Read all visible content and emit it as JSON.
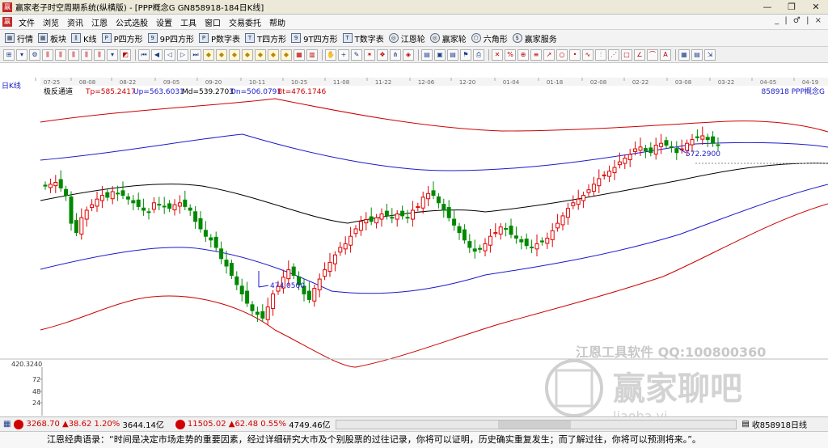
{
  "window": {
    "title": "赢家老子时空周期系统(纵横版) - [PPP概念G  GN858918-184日K线]",
    "min_label": "—",
    "max_label": "❐",
    "close_label": "✕"
  },
  "menu": {
    "items": [
      "文件",
      "浏览",
      "资讯",
      "江恩",
      "公式选股",
      "设置",
      "工具",
      "窗口",
      "交易委托",
      "帮助"
    ],
    "mdi_controls": "_ | ♂ | ×"
  },
  "toolbar1": {
    "items": [
      {
        "label": "行情",
        "icon": "grid-icon",
        "glyph": "▦"
      },
      {
        "label": "板块",
        "icon": "block-icon",
        "glyph": "▦"
      },
      {
        "label": "K线",
        "icon": "kline-icon",
        "glyph": "⫼"
      },
      {
        "label": "P四方形",
        "icon": "p-square-icon",
        "glyph": "P"
      },
      {
        "label": "9P四方形",
        "icon": "9p-square-icon",
        "glyph": "9P"
      },
      {
        "label": "P数字表",
        "icon": "p-table-icon",
        "glyph": "PN"
      },
      {
        "label": "T四方形",
        "icon": "t-square-icon",
        "glyph": "T"
      },
      {
        "label": "9T四方形",
        "icon": "9t-square-icon",
        "glyph": "9T"
      },
      {
        "label": "T数字表",
        "icon": "t-table-icon",
        "glyph": "TN"
      },
      {
        "label": "江恩轮",
        "icon": "gann-wheel-icon",
        "glyph": "◎"
      },
      {
        "label": "赢家轮",
        "icon": "winner-wheel-icon",
        "glyph": "◎"
      },
      {
        "label": "六角形",
        "icon": "hexagon-icon",
        "glyph": "⬡"
      },
      {
        "label": "赢家服务",
        "icon": "service-icon",
        "glyph": "$"
      }
    ]
  },
  "chart": {
    "period_label": "日K线",
    "indicator": {
      "name": "极反通道",
      "tp": "Tp=585.2417",
      "up": "Up=563.6031",
      "md": "Md=539.2703",
      "dn": "Dn=506.0791",
      "bt": "Bt=476.1746"
    },
    "stock_label": "858918 PPP概念G",
    "date_ticks": [
      "07-25",
      "08-08",
      "08-22",
      "09-05",
      "09-20",
      "10-11",
      "10-25",
      "11-08",
      "11-22",
      "12-06",
      "12-20",
      "01-04",
      "01-18",
      "02-08",
      "02-22",
      "03-08",
      "03-22",
      "04-05",
      "04-19"
    ],
    "low_annotation": "474.0500",
    "high_annotation": "572.2900",
    "axis_value": "420.3240",
    "volume_ticks": [
      "72",
      "48",
      "24"
    ],
    "colors": {
      "up_candle": "#e00000",
      "down_candle": "#008800",
      "outer_band": "#cc0000",
      "inner_band": "#1a1acc",
      "mid_line": "#000000"
    }
  },
  "watermark": {
    "line1": "江恩工具软件  QQ:100800360",
    "logo_text": "赢家聊吧",
    "url": "liaoba.yj..."
  },
  "statusbar": {
    "sh_price": "3268.70",
    "sh_change": "▲38.62",
    "sh_pct": "1.20%",
    "sh_amount": "3644.14亿",
    "sz_price": "11505.02",
    "sz_change": "▲62.48",
    "sz_pct": "0.55%",
    "sz_amount": "4749.46亿",
    "current": "收858918日线"
  },
  "quote": {
    "text": "江恩经典语录：“时间是决定市场走势的重要因素，经过详细研究大市及个别股票的过往记录，你将可以证明，历史确实重复发生；而了解过往，你将可以预测将来。”。"
  }
}
